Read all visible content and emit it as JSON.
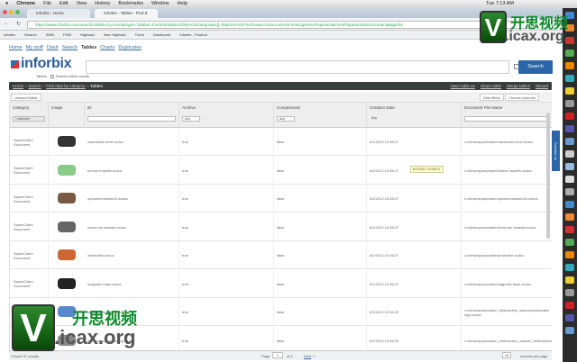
{
  "menubar": {
    "items": [
      "Chrome",
      "File",
      "Edit",
      "View",
      "History",
      "Bookmarks",
      "Window",
      "Help"
    ],
    "clock": "Tue 7:13 AM"
  },
  "tabs": [
    {
      "label": "Inforbix - Home"
    },
    {
      "label": "Inforbix - Tables - Find d"
    }
  ],
  "url": "https://www.inforbix.com/search/stables?q=%2A&ctype=7&label=Find%20data%20by%20category&c[]=http%3A%2F%2Fwww.ms2w.com%2Fontologies%2Fspaceclaim%2FSpaceClaimDocument&appcha",
  "bookmarks": [
    "Inforbix",
    "iSearch",
    "SWN",
    "PDM",
    "Highload",
    "New Highload",
    "Trunk",
    "Dashboard",
    "Inforbix - Product"
  ],
  "nav": {
    "items": [
      "Home",
      "My stuff",
      "Dash",
      "Search",
      "Tables",
      "Charts",
      "Duplicates"
    ],
    "current": "Tables"
  },
  "logo": {
    "name": "inforbix",
    "sub": "Tables"
  },
  "search": {
    "within_label": "Search within results",
    "value": "",
    "button": "Search"
  },
  "breadcrumb": {
    "items": [
      "Home",
      "Search",
      "Find data by category"
    ],
    "current": "Tables",
    "links": [
      "Save table as",
      "Share table",
      "Merge tables",
      "Wizard"
    ]
  },
  "toolbar": {
    "table_name": "Unsaved table",
    "hide_filters": "Hide filters",
    "choose_columns": "Choose columns"
  },
  "columns": [
    {
      "label": "Category",
      "filter": "1 selected"
    },
    {
      "label": "Image",
      "filter": ""
    },
    {
      "label": "ID",
      "filter": ""
    },
    {
      "label": "Archive",
      "filter": "Any"
    },
    {
      "label": "Compressed",
      "filter": "Any"
    },
    {
      "label": "Creation Date",
      "filter": "Any"
    },
    {
      "label": "Document File Name",
      "filter": ""
    }
  ],
  "rows": [
    {
      "category": "SpaceClaim Document",
      "id": "machinists level.scdoc",
      "archive": "true",
      "compressed": "false",
      "date": "6/1/2012 10:06:27",
      "file": "z:\\demo\\spaceclaim\\machinists level.scdoc"
    },
    {
      "category": "SpaceClaim Document",
      "id": "turbine impeller.scdoc",
      "archive": "true",
      "compressed": "false",
      "date": "6/1/2012 10:06:27",
      "file": "z:\\demo\\spaceclaim\\turbine impeller.scdoc"
    },
    {
      "category": "SpaceClaim Document",
      "id": "opusmechanism10.scdoc",
      "archive": "true",
      "compressed": "false",
      "date": "6/1/2012 10:06:27",
      "file": "z:\\demo\\spaceclaim\\opusmechanism10.scdoc"
    },
    {
      "category": "SpaceClaim Document",
      "id": "screw pin shackle.scdoc",
      "archive": "true",
      "compressed": "false",
      "date": "6/1/2012 10:06:27",
      "file": "z:\\demo\\spaceclaim\\screw pin shackle.scdoc"
    },
    {
      "category": "SpaceClaim Document",
      "id": "winebottle.scdoc",
      "archive": "true",
      "compressed": "false",
      "date": "6/1/2012 10:06:27",
      "file": "z:\\demo\\spaceclaim\\winebottle.scdoc"
    },
    {
      "category": "SpaceClaim Document",
      "id": "magnetic base.scdoc",
      "archive": "true",
      "compressed": "false",
      "date": "6/1/2012 10:06:27",
      "file": "z:\\demo\\spaceclaim\\magnetic base.scdoc"
    },
    {
      "category": "SpaceClaim Document",
      "id": "spaceclaim logo.scdoc",
      "archive": "true",
      "compressed": "false",
      "date": "6/1/2012 10:06:29",
      "file": "z:\\demo\\spaceclaim\\_belleveders_assem\\spaceclaim logo.scdoc"
    },
    {
      "category": "SpaceClaim Document",
      "id": "belleveders_assembly.scdoc",
      "archive": "true",
      "compressed": "false",
      "date": "6/1/2012 10:06:29",
      "file": "z:\\demo\\spaceclaim\\_belleveders_assem\\_belleveders_assembly.scdoc"
    }
  ],
  "tooltip": "6/1/2012 10:06:27",
  "footer": {
    "found": "Found 37 results",
    "page_label": "Page",
    "page": "1",
    "of": "of 2",
    "next": "Next",
    "per_page": "25",
    "per_page_label": "records per page"
  },
  "contact": "Contact Us",
  "watermark": {
    "cn": "开思视频",
    "site": ".icax.org",
    "v": "V"
  },
  "colors": {
    "accent": "#2a65a8",
    "breadcrumb_bg": "#3a3e3c"
  }
}
